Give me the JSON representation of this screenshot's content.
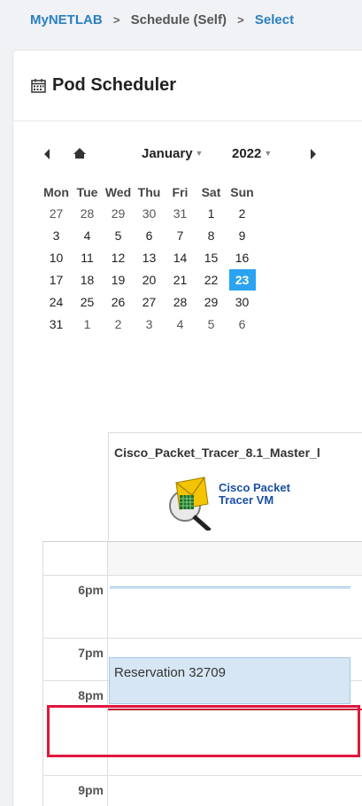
{
  "breadcrumb": {
    "home": "MyNETLAB",
    "middle": "Schedule (Self)",
    "current": "Select",
    "separator": ">"
  },
  "panel": {
    "title": "Pod Scheduler"
  },
  "calendar": {
    "month": "January",
    "year": "2022",
    "weekdays": [
      "Mon",
      "Tue",
      "Wed",
      "Thu",
      "Fri",
      "Sat",
      "Sun"
    ],
    "weeks": [
      [
        "27",
        "28",
        "29",
        "30",
        "31",
        "1",
        "2"
      ],
      [
        "3",
        "4",
        "5",
        "6",
        "7",
        "8",
        "9"
      ],
      [
        "10",
        "11",
        "12",
        "13",
        "14",
        "15",
        "16"
      ],
      [
        "17",
        "18",
        "19",
        "20",
        "21",
        "22",
        "23"
      ],
      [
        "24",
        "25",
        "26",
        "27",
        "28",
        "29",
        "30"
      ],
      [
        "31",
        "1",
        "2",
        "3",
        "4",
        "5",
        "6"
      ]
    ],
    "selected_day": "23"
  },
  "resource": {
    "name": "Cisco_Packet_Tracer_8.1_Master_l",
    "logo_line1": "Cisco Packet",
    "logo_line2": "Tracer VM"
  },
  "schedule": {
    "times": [
      "6pm",
      "7pm",
      "8pm",
      "9pm"
    ],
    "reservation_label": "Reservation 32709"
  },
  "colors": {
    "accent": "#29a3f2",
    "highlight": "#e0173d",
    "reservation_fill": "#d6e6f4"
  }
}
